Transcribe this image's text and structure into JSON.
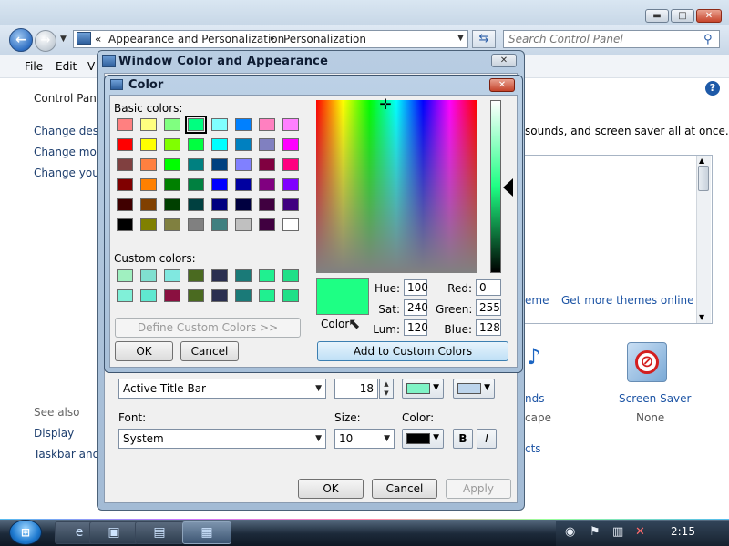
{
  "explorer": {
    "breadcrumb": {
      "prefix": "«",
      "item1": "Appearance and Personalization",
      "sep": "▸",
      "item2": "Personalization"
    },
    "search_placeholder": "Search Control Panel",
    "menu": {
      "file": "File",
      "edit": "Edit",
      "view": "V"
    },
    "left_panel": {
      "home": "Control Panel",
      "link1": "Change des",
      "link2": "Change mo",
      "link3": "Change you",
      "see_also": "See also",
      "display": "Display",
      "taskbar": "Taskbar and"
    },
    "content": {
      "intro_tail": "sounds, and screen saver all at once.",
      "theme_link_tail": "eme",
      "get_more_themes": "Get more themes online",
      "sounds_label_tail": "nds",
      "sounds_sub_tail": "cape",
      "effects_tail": "cts",
      "screen_saver_label": "Screen Saver",
      "screen_saver_value": "None"
    }
  },
  "wca_dialog": {
    "title": "Window Color and Appearance",
    "item_value": "Active Title Bar",
    "size_value": "18",
    "font_label": "Font:",
    "size_label": "Size:",
    "color_label": "Color:",
    "font_value": "System",
    "font_size_value": "10",
    "bold_label": "B",
    "italic_label": "I",
    "color1": "#7ff3c6",
    "color2": "#bcd4ec",
    "font_color": "#000000",
    "ok": "OK",
    "cancel": "Cancel",
    "apply": "Apply"
  },
  "color_dialog": {
    "title": "Color",
    "basic_colors_label": "Basic colors:",
    "custom_colors_label": "Custom colors:",
    "basic_colors": [
      "#ff8080",
      "#ffff80",
      "#80ff80",
      "#00ff80",
      "#80ffff",
      "#0080ff",
      "#ff80c0",
      "#ff80ff",
      "#ff0000",
      "#ffff00",
      "#80ff00",
      "#00ff40",
      "#00ffff",
      "#0080c0",
      "#8080c0",
      "#ff00ff",
      "#804040",
      "#ff8040",
      "#00ff00",
      "#008080",
      "#004080",
      "#8080ff",
      "#800040",
      "#ff0080",
      "#800000",
      "#ff8000",
      "#008000",
      "#008040",
      "#0000ff",
      "#0000a0",
      "#800080",
      "#8000ff",
      "#400000",
      "#804000",
      "#004000",
      "#004040",
      "#000080",
      "#000040",
      "#400040",
      "#400080",
      "#000000",
      "#808000",
      "#808040",
      "#808080",
      "#408080",
      "#c0c0c0",
      "#400040",
      "#ffffff"
    ],
    "selected_basic_index": 3,
    "custom_colors": [
      "#a0f0c0",
      "#80e0d0",
      "#80e8e0",
      "#4a6a20",
      "#2a2f50",
      "#1a7a78",
      "#20f090",
      "#20e088",
      "#80f0d8",
      "#60e8d0",
      "#8a1040",
      "#4a6a20",
      "#2a2f50",
      "#1a7a78",
      "#20f090",
      "#20e088"
    ],
    "define_custom": "Define Custom Colors >>",
    "ok": "OK",
    "cancel": "Cancel",
    "preview_label": "Color",
    "current_color": "#1eff84",
    "hue_label": "Hue:",
    "hue": "100",
    "sat_label": "Sat:",
    "sat": "240",
    "lum_label": "Lum:",
    "lum": "120",
    "red_label": "Red:",
    "red": "0",
    "green_label": "Green:",
    "green": "255",
    "blue_label": "Blue:",
    "blue": "128",
    "add_custom": "Add to Custom Colors"
  },
  "taskbar": {
    "clock": "2:15"
  }
}
